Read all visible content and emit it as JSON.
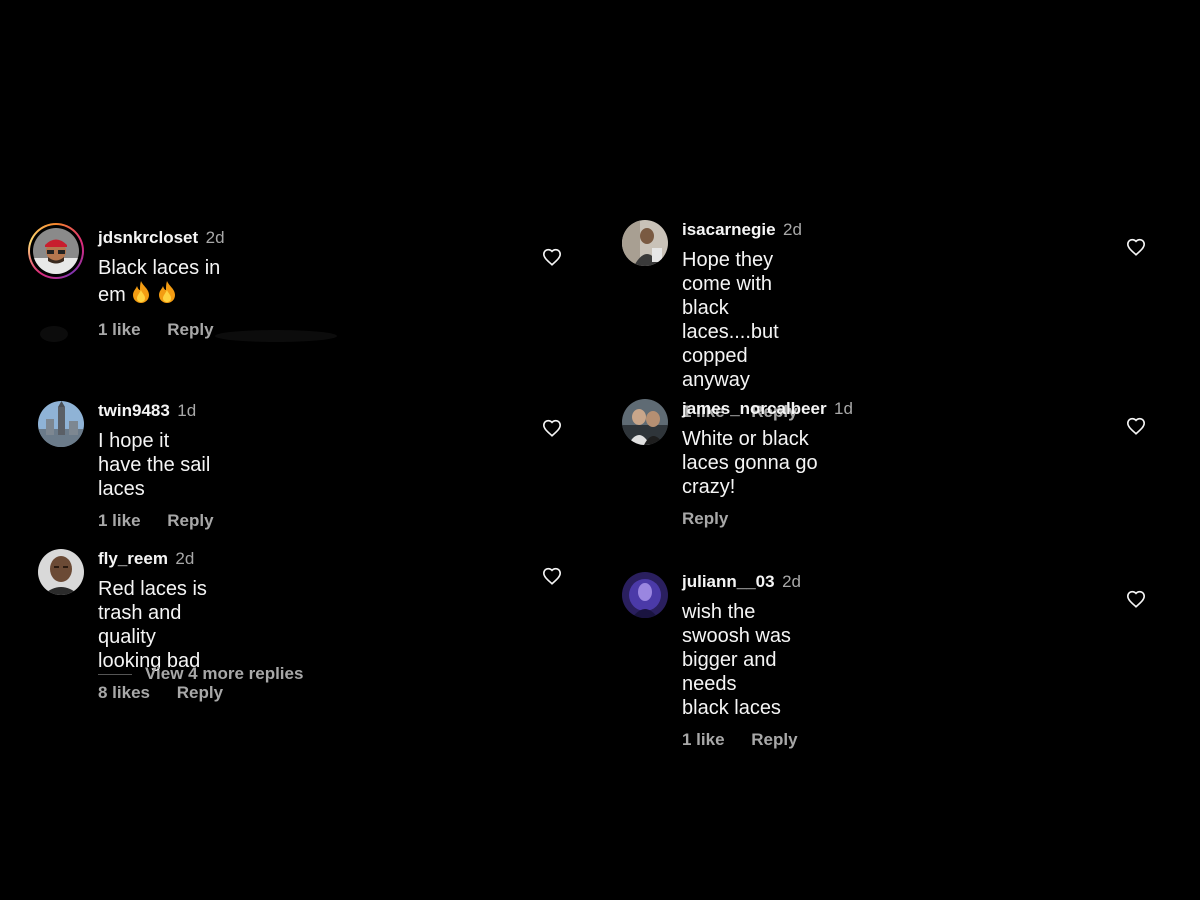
{
  "colors": {
    "background": "#000000",
    "text": "#f5f5f5",
    "muted": "#a8a8a8"
  },
  "left_column": {
    "comments": [
      {
        "username": "jdsnkrcloset",
        "time": "2d",
        "text": "Black laces in em",
        "emoji": [
          "fire-icon",
          "fire-icon"
        ],
        "likes": "1 like",
        "reply": "Reply",
        "story_ring": true
      },
      {
        "username": "twin9483",
        "time": "1d",
        "text": "I hope it have the sail laces",
        "likes": "1 like",
        "reply": "Reply"
      },
      {
        "username": "fly_reem",
        "time": "2d",
        "text": "Red laces is trash and quality looking bad",
        "likes": "8 likes",
        "reply": "Reply"
      }
    ],
    "view_more": "View 4 more replies"
  },
  "right_column": {
    "comments": [
      {
        "username": "isacarnegie",
        "time": "2d",
        "text_lines": [
          "Hope they come with black laces....but",
          "copped anyway"
        ],
        "likes": "1 like",
        "reply": "Reply"
      },
      {
        "username": "james_norcalbeer",
        "time": "1d",
        "text": "White or black laces gonna go crazy!",
        "likes": "",
        "reply": "Reply"
      },
      {
        "username": "juliann__03",
        "time": "2d",
        "text_lines": [
          "wish the swoosh was bigger and needs",
          "black laces"
        ],
        "likes": "1 like",
        "reply": "Reply"
      }
    ]
  }
}
